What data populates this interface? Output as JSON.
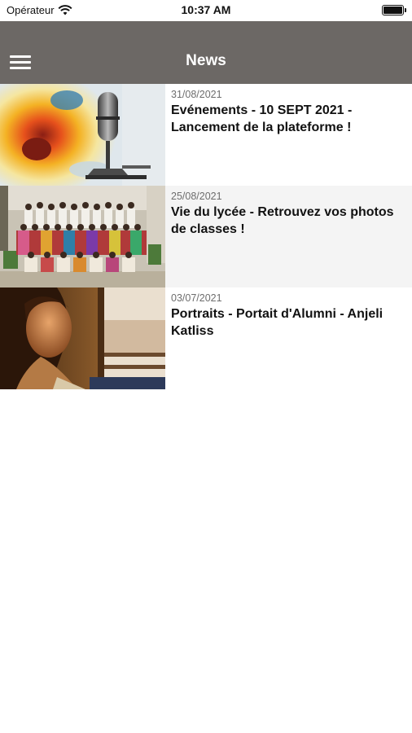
{
  "status_bar": {
    "carrier": "Opérateur",
    "time": "10:37 AM"
  },
  "nav": {
    "title": "News"
  },
  "news": [
    {
      "date": "31/08/2021",
      "title": "Evénements - 10 SEPT 2021 - Lancement de la plateforme !"
    },
    {
      "date": "25/08/2021",
      "title": "Vie du lycée - Retrouvez vos photos de classes !"
    },
    {
      "date": "03/07/2021",
      "title": "Portraits - Portait d'Alumni - Anjeli Katliss"
    }
  ]
}
